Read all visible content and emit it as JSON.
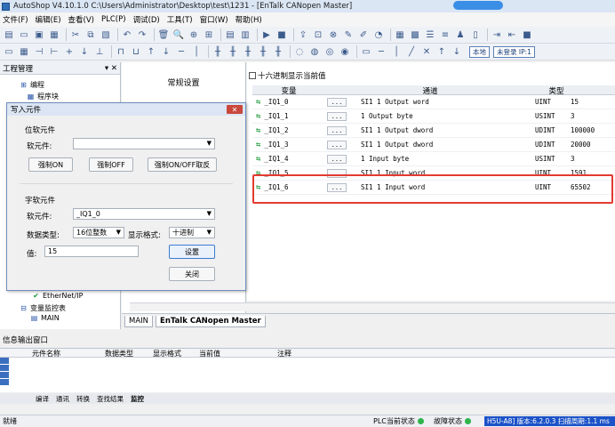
{
  "window": {
    "title": "AutoShop V4.10.1.0  C:\\Users\\Administrator\\Desktop\\test\\1231 - [EnTalk CANopen Master]"
  },
  "menu": [
    "文件(F)",
    "编辑(E)",
    "查看(V)",
    "PLC(P)",
    "调试(D)",
    "工具(T)",
    "窗口(W)",
    "帮助(H)"
  ],
  "toolbar": {
    "local_label": "本地",
    "login_label": "未登录 IP:1"
  },
  "project_pane": {
    "title": "工程管理",
    "close_glyph": "✕",
    "pin_glyph": "▾",
    "items": [
      "编程",
      "程序块",
      "EtherNet/IP",
      "变量监控表",
      "MAIN"
    ]
  },
  "settings_pane": {
    "title": "常规设置"
  },
  "main": {
    "hex_display_label": "十六进制显示当前值",
    "columns": {
      "variable": "变量",
      "channel": "通道",
      "type": "类型"
    },
    "rows": [
      {
        "variable": "_IQ1_0",
        "channel": "SI1 1 Output word",
        "type": "UINT",
        "value": "15"
      },
      {
        "variable": "_IQ1_1",
        "channel": "1 Output byte",
        "type": "USINT",
        "value": "3"
      },
      {
        "variable": "_IQ1_2",
        "channel": "SI1 1 Output dword",
        "type": "UDINT",
        "value": "100000"
      },
      {
        "variable": "_IQ1_3",
        "channel": "SI1 1 Output dword",
        "type": "UDINT",
        "value": "20000"
      },
      {
        "variable": "_IQ1_4",
        "channel": "1 Input byte",
        "type": "USINT",
        "value": "3"
      },
      {
        "variable": "_IQ1_5",
        "channel": "SI1 1 Input word",
        "type": "UINT",
        "value": "1591"
      },
      {
        "variable": "_IQ1_6",
        "channel": "SI1 1 Input word",
        "type": "UINT",
        "value": "65502"
      }
    ],
    "dots_label": "..."
  },
  "tabs": {
    "main": "MAIN",
    "entalk": "EnTalk CANopen Master"
  },
  "info": {
    "title": "信息输出窗口",
    "columns": [
      "元件名称",
      "数据类型",
      "显示格式",
      "当前值",
      "注释"
    ],
    "bottom_tabs": [
      "编译",
      "通讯",
      "转换",
      "查找结果",
      "监控"
    ]
  },
  "status": {
    "ready": "就绪",
    "plc_state": "PLC当前状态",
    "fault_state": "故障状态",
    "blue_text": "H5U-A8] 版本:6.2.0.3 扫描周期:1.1 ms"
  },
  "dialog": {
    "title": "写入元件",
    "close_glyph": "✕",
    "bit_group": "位软元件",
    "bit_element_label": "软元件:",
    "bit_element_value": "",
    "force_on": "强制ON",
    "force_off": "强制OFF",
    "force_toggle": "强制ON/OFF取反",
    "word_group": "字软元件",
    "word_element_label": "软元件:",
    "word_element_value": "_IQ1_0",
    "data_type_label": "数据类型:",
    "data_type_value": "16位整数",
    "display_format_label": "显示格式:",
    "display_format_value": "十进制",
    "value_label": "值:",
    "value": "15",
    "set_button": "设置",
    "close_button": "关闭"
  }
}
